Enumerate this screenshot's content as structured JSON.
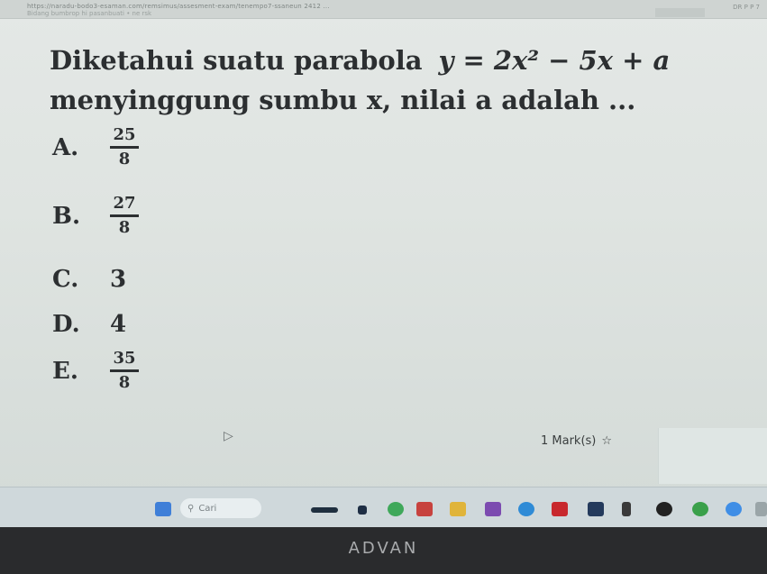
{
  "browser": {
    "url_text": "https://naradu-bodo3-esaman.com/remsimus/assesment-exam/tenempo7-ssaneun 2412 ...",
    "bookmarks_text": "Bidang bumbrop hi pasanbuati • ne rsk",
    "right_text": "DR P P 7"
  },
  "question": {
    "text_prefix": "Diketahui suatu parabola",
    "equation": "y = 2x² − 5x + a",
    "text_line2": "menyinggung sumbu x, nilai a adalah ..."
  },
  "options": [
    {
      "letter": "A.",
      "numerator": "25",
      "denominator": "8",
      "value": ""
    },
    {
      "letter": "B.",
      "numerator": "27",
      "denominator": "8",
      "value": ""
    },
    {
      "letter": "C.",
      "numerator": "",
      "denominator": "",
      "value": "3"
    },
    {
      "letter": "D.",
      "numerator": "",
      "denominator": "",
      "value": "4"
    },
    {
      "letter": "E.",
      "numerator": "35",
      "denominator": "8",
      "value": ""
    }
  ],
  "mark": {
    "label": "1 Mark(s)",
    "icon": "star-outline-icon"
  },
  "taskbar": {
    "search_placeholder": "Cari",
    "icons": [
      "windows-start-icon",
      "search-icon",
      "widgets-icon",
      "file-explorer-icon",
      "store-icon",
      "edge-icon",
      "office-icon",
      "mail-icon",
      "chrome-icon",
      "youtube-icon",
      "photos-icon",
      "app-icon",
      "chrome-icon",
      "settings-icon",
      "app-icon"
    ]
  },
  "bezel": {
    "brand": "ADVAN"
  }
}
